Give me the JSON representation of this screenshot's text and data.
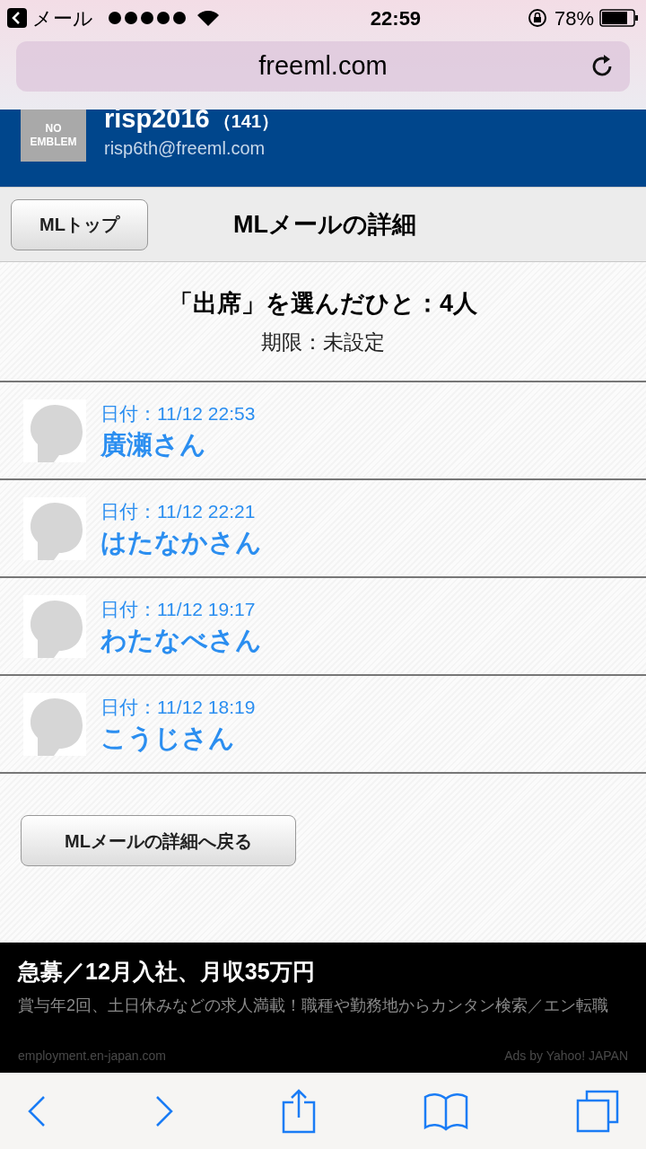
{
  "status_bar": {
    "back_app": "メール",
    "time": "22:59",
    "battery": "78%"
  },
  "address_bar": {
    "url": "freeml.com"
  },
  "group_header": {
    "emblem": "NO EMBLEM",
    "name": "risp2016",
    "count": "（141）",
    "email": "risp6th@freeml.com"
  },
  "toolbar": {
    "top_button": "MLトップ",
    "title": "MLメールの詳細"
  },
  "summary": {
    "heading": "「出席」を選んだひと：4人",
    "deadline": "期限：未設定"
  },
  "people": [
    {
      "date": "日付：11/12 22:53",
      "name": "廣瀬さん"
    },
    {
      "date": "日付：11/12 22:21",
      "name": "はたなかさん"
    },
    {
      "date": "日付：11/12 19:17",
      "name": "わたなべさん"
    },
    {
      "date": "日付：11/12 18:19",
      "name": "こうじさん"
    }
  ],
  "back_button": "MLメールの詳細へ戻る",
  "ad": {
    "title": "急募／12月入社、月収35万円",
    "body": "賞与年2回、土日休みなどの求人満載！職種や勤務地からカンタン検索／エン転職",
    "domain": "employment.en-japan.com",
    "credit": "Ads by Yahoo! JAPAN"
  }
}
